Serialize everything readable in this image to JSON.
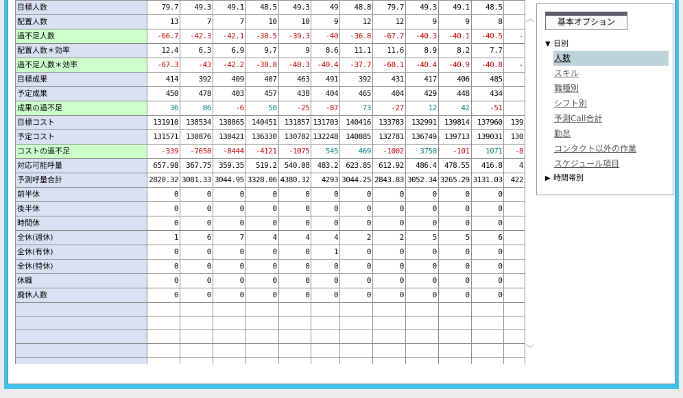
{
  "grid": {
    "rows": [
      {
        "label": "目標人数",
        "hl": false,
        "values": [
          "79.7",
          "49.3",
          "49.1",
          "48.5",
          "49.3",
          "49",
          "48.8",
          "79.7",
          "49.3",
          "49.1",
          "48.5"
        ],
        "cls": ""
      },
      {
        "label": "配置人数",
        "hl": false,
        "values": [
          "13",
          "7",
          "7",
          "10",
          "10",
          "9",
          "12",
          "12",
          "9",
          "9",
          "8"
        ],
        "cls": ""
      },
      {
        "label": "過不足人数",
        "hl": true,
        "values": [
          "-66.7",
          "-42.3",
          "-42.1",
          "-38.5",
          "-39.3",
          "-40",
          "-36.8",
          "-67.7",
          "-40.3",
          "-40.1",
          "-40.5",
          "-"
        ],
        "cls": "neg"
      },
      {
        "label": "配置人数＊効率",
        "hl": false,
        "values": [
          "12.4",
          "6.3",
          "6.9",
          "9.7",
          "9",
          "8.6",
          "11.1",
          "11.6",
          "8.9",
          "8.2",
          "7.7"
        ],
        "cls": ""
      },
      {
        "label": "過不足人数＊効率",
        "hl": true,
        "values": [
          "-67.3",
          "-43",
          "-42.2",
          "-38.8",
          "-40.3",
          "-40.4",
          "-37.7",
          "-68.1",
          "-40.4",
          "-40.9",
          "-40.8",
          "-"
        ],
        "cls": "neg"
      },
      {
        "label": "目標成果",
        "hl": false,
        "values": [
          "414",
          "392",
          "409",
          "407",
          "463",
          "491",
          "392",
          "431",
          "417",
          "406",
          "485"
        ],
        "cls": ""
      },
      {
        "label": "予定成果",
        "hl": false,
        "values": [
          "450",
          "478",
          "403",
          "457",
          "438",
          "404",
          "465",
          "404",
          "429",
          "448",
          "434"
        ],
        "cls": ""
      },
      {
        "label": "成果の過不足",
        "hl": true,
        "values": [
          "36",
          "86",
          "-6",
          "50",
          "-25",
          "-87",
          "73",
          "-27",
          "12",
          "42",
          "-51"
        ],
        "cls": "mixed"
      },
      {
        "label": "目標コスト",
        "hl": false,
        "values": [
          "131910",
          "138534",
          "138865",
          "140451",
          "131857",
          "131703",
          "140416",
          "133783",
          "132991",
          "139814",
          "137960",
          "139"
        ],
        "cls": ""
      },
      {
        "label": "予定コスト",
        "hl": false,
        "values": [
          "131571",
          "130876",
          "130421",
          "136330",
          "130782",
          "132248",
          "140885",
          "132781",
          "136749",
          "139713",
          "139031",
          "130"
        ],
        "cls": ""
      },
      {
        "label": "コストの過不足",
        "hl": true,
        "values": [
          "-339",
          "-7658",
          "-8444",
          "-4121",
          "-1075",
          "545",
          "469",
          "-1002",
          "3758",
          "-101",
          "1071",
          "-8"
        ],
        "cls": "mixed"
      },
      {
        "label": "対応可能呼量",
        "hl": false,
        "values": [
          "657.98",
          "367.75",
          "359.35",
          "519.2",
          "540.08",
          "483.2",
          "623.85",
          "612.92",
          "486.4",
          "478.55",
          "416.8",
          "4"
        ],
        "cls": ""
      },
      {
        "label": "予測呼量合計",
        "hl": false,
        "values": [
          "2820.32",
          "3081.33",
          "3044.95",
          "3328.06",
          "4380.32",
          "4293",
          "3044.25",
          "2843.83",
          "3052.34",
          "3265.29",
          "3131.03",
          "422"
        ],
        "cls": ""
      },
      {
        "label": "前半休",
        "hl": false,
        "values": [
          "0",
          "0",
          "0",
          "0",
          "0",
          "0",
          "0",
          "0",
          "0",
          "0",
          "0"
        ],
        "cls": ""
      },
      {
        "label": "後半休",
        "hl": false,
        "values": [
          "0",
          "0",
          "0",
          "0",
          "0",
          "0",
          "0",
          "0",
          "0",
          "0",
          "0"
        ],
        "cls": ""
      },
      {
        "label": "時間休",
        "hl": false,
        "values": [
          "0",
          "0",
          "0",
          "0",
          "0",
          "0",
          "0",
          "0",
          "0",
          "0",
          "0"
        ],
        "cls": ""
      },
      {
        "label": "全休(週休)",
        "hl": false,
        "values": [
          "1",
          "6",
          "7",
          "4",
          "4",
          "4",
          "2",
          "2",
          "5",
          "5",
          "6"
        ],
        "cls": ""
      },
      {
        "label": "全休(有休)",
        "hl": false,
        "values": [
          "0",
          "0",
          "0",
          "0",
          "0",
          "1",
          "0",
          "0",
          "0",
          "0",
          "0"
        ],
        "cls": ""
      },
      {
        "label": "全休(特休)",
        "hl": false,
        "values": [
          "0",
          "0",
          "0",
          "0",
          "0",
          "0",
          "0",
          "0",
          "0",
          "0",
          "0"
        ],
        "cls": ""
      },
      {
        "label": "休職",
        "hl": false,
        "values": [
          "0",
          "0",
          "0",
          "0",
          "0",
          "0",
          "0",
          "0",
          "0",
          "0",
          "0"
        ],
        "cls": ""
      },
      {
        "label": "廃休人数",
        "hl": false,
        "values": [
          "0",
          "0",
          "0",
          "0",
          "0",
          "0",
          "0",
          "0",
          "0",
          "0",
          "0"
        ],
        "cls": ""
      },
      {
        "label": "",
        "hl": false,
        "values": [],
        "cls": ""
      },
      {
        "label": "",
        "hl": false,
        "values": [],
        "cls": ""
      },
      {
        "label": "",
        "hl": false,
        "values": [],
        "cls": ""
      },
      {
        "label": "",
        "hl": false,
        "values": [],
        "cls": ""
      },
      {
        "label": "",
        "hl": false,
        "values": [],
        "cls": ""
      }
    ],
    "column_count": 12
  },
  "scrollbar": {
    "up_icon": "chevron-up-icon",
    "down_icon": "chevron-down-icon",
    "up_glyph": "︿",
    "down_glyph": "﹀"
  },
  "options": {
    "header": "基本オプション",
    "daily": {
      "label": "日別",
      "expanded": true,
      "arrow": "▼"
    },
    "daily_items": [
      "人数",
      "スキル",
      "職種別",
      "シフト別",
      "予測Call合計",
      "勤怠",
      "コンタクト以外の作業",
      "スケジュール項目"
    ],
    "active_item": "人数",
    "hourly": {
      "label": "時間帯別",
      "expanded": false,
      "arrow": "▶"
    }
  },
  "colors": {
    "negative": "#c00000",
    "positive": "#008080",
    "label_bg": "#d9e1f2",
    "highlight_bg": "#ccffcc",
    "frame": "#3fc3ea",
    "active_item_bg": "#bcd3dc"
  }
}
